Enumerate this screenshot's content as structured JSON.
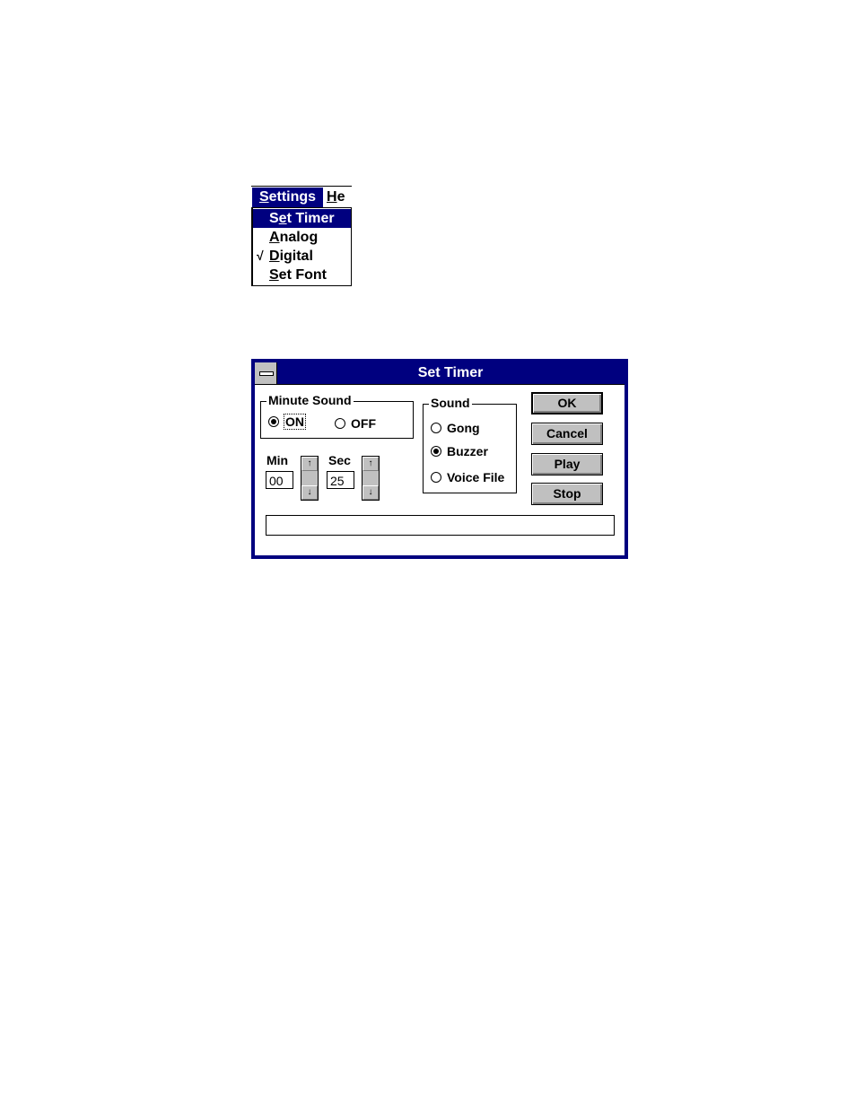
{
  "menu": {
    "title": "Settings",
    "title_mnemonic": "S",
    "title_rest": "ettings",
    "next_menu_partial": "He",
    "next_menu_mnemonic": "H",
    "next_menu_rest": "e",
    "items": [
      {
        "label": "Set Timer",
        "pre": "S",
        "mnemonic": "e",
        "post": "t Timer",
        "checked": false,
        "selected": true
      },
      {
        "label": "Analog",
        "pre": "",
        "mnemonic": "A",
        "post": "nalog",
        "checked": false,
        "selected": false
      },
      {
        "label": "Digital",
        "pre": "",
        "mnemonic": "D",
        "post": "igital",
        "checked": true,
        "selected": false
      },
      {
        "label": "Set Font",
        "pre": "",
        "mnemonic": "S",
        "post": "et Font",
        "checked": false,
        "selected": false
      }
    ],
    "check_glyph": "√"
  },
  "dialog": {
    "title": "Set Timer",
    "minute_sound": {
      "label": "Minute Sound",
      "options": [
        {
          "label": "ON",
          "selected": true
        },
        {
          "label": "OFF",
          "selected": false
        }
      ]
    },
    "min": {
      "label": "Min",
      "value": "00"
    },
    "sec": {
      "label": "Sec",
      "value": "25"
    },
    "spin_up_glyph": "↑",
    "spin_down_glyph": "↓",
    "sound": {
      "label": "Sound",
      "options": [
        {
          "label": "Gong",
          "selected": false
        },
        {
          "label": "Buzzer",
          "selected": true
        },
        {
          "label": "Voice File",
          "selected": false
        }
      ]
    },
    "buttons": {
      "ok": "OK",
      "cancel": "Cancel",
      "play": "Play",
      "stop": "Stop"
    },
    "status_text": ""
  }
}
